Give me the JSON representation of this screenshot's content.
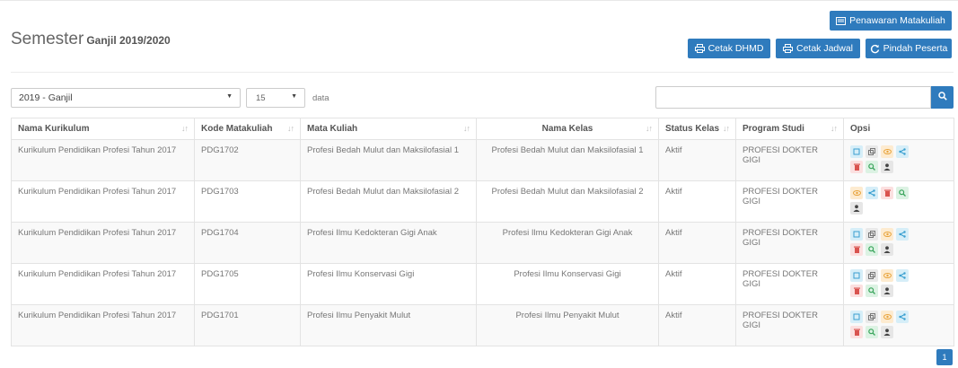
{
  "header": {
    "title": "Semester",
    "semester": "Ganjil 2019/2020"
  },
  "buttons": {
    "penawaran": "Penawaran Matakuliah",
    "cetak_dhmd": "Cetak DHMD",
    "cetak_jadwal": "Cetak Jadwal",
    "pindah_peserta": "Pindah Peserta"
  },
  "filters": {
    "semester_select": "2019 - Ganjil",
    "page_length": "15",
    "page_length_suffix": "data",
    "search_value": ""
  },
  "table": {
    "headers": [
      "Nama Kurikulum",
      "Kode Matakuliah",
      "Mata Kuliah",
      "Nama Kelas",
      "Status Kelas",
      "Program Studi",
      "Opsi"
    ],
    "rows": [
      {
        "kurikulum": "Kurikulum Pendidikan Profesi Tahun 2017",
        "kode": "PDG1702",
        "matkul": "Profesi Bedah Mulut dan Maksilofasial 1",
        "kelas": "Profesi Bedah Mulut dan Maksilofasial 1",
        "status": "Aktif",
        "prodi": "PROFESI DOKTER GIGI"
      },
      {
        "kurikulum": "Kurikulum Pendidikan Profesi Tahun 2017",
        "kode": "PDG1703",
        "matkul": "Profesi Bedah Mulut dan Maksilofasial 2",
        "kelas": "Profesi Bedah Mulut dan Maksilofasial 2",
        "status": "Aktif",
        "prodi": "PROFESI DOKTER GIGI"
      },
      {
        "kurikulum": "Kurikulum Pendidikan Profesi Tahun 2017",
        "kode": "PDG1704",
        "matkul": "Profesi Ilmu Kedokteran Gigi Anak",
        "kelas": "Profesi Ilmu Kedokteran Gigi Anak",
        "status": "Aktif",
        "prodi": "PROFESI DOKTER GIGI"
      },
      {
        "kurikulum": "Kurikulum Pendidikan Profesi Tahun 2017",
        "kode": "PDG1705",
        "matkul": "Profesi Ilmu Konservasi Gigi",
        "kelas": "Profesi Ilmu Konservasi Gigi",
        "status": "Aktif",
        "prodi": "PROFESI DOKTER GIGI"
      },
      {
        "kurikulum": "Kurikulum Pendidikan Profesi Tahun 2017",
        "kode": "PDG1701",
        "matkul": "Profesi Ilmu Penyakit Mulut",
        "kelas": "Profesi Ilmu Penyakit Mulut",
        "status": "Aktif",
        "prodi": "PROFESI DOKTER GIGI"
      }
    ]
  },
  "pagination": {
    "current": "1"
  },
  "colors": {
    "primary": "#2f7bbd"
  }
}
